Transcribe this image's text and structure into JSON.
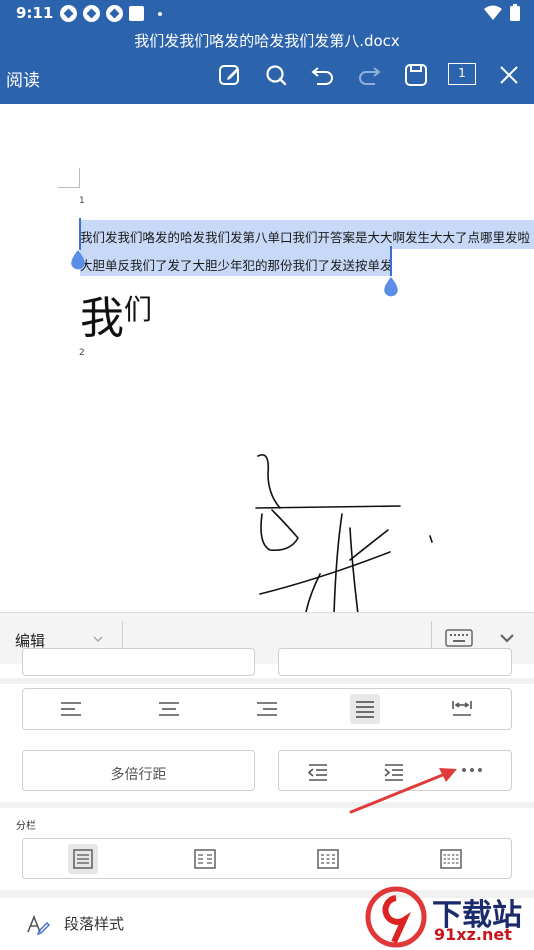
{
  "status": {
    "time": "9:11"
  },
  "titlebar": {
    "doc_title": "我们发我们咯发的哈发我们发第八.docx",
    "mode": "阅读",
    "page_indicator": "1"
  },
  "icons": [
    "edit-icon",
    "search-icon",
    "undo-icon",
    "redo-icon",
    "save-icon",
    "page-icon",
    "close-icon",
    "keyboard-icon",
    "chevron-down-icon",
    "more-icon",
    "paragraph-style-icon"
  ],
  "document": {
    "page1_number": "1",
    "line1": "我们发我们咯发的哈发我们发第八单口我们开答案是大大啊发生大大了点哪里发啦",
    "line2": "大胆单反我们了发了大胆少年犯的那份我们了发送按单发",
    "big_text_1": "我",
    "big_text_2": "们",
    "page2_number": "2"
  },
  "panel": {
    "edit_label": "编辑",
    "line_spacing_label": "多倍行距",
    "columns_label": "分栏",
    "paragraph_style_label": "段落样式"
  },
  "watermark": {
    "brand": "下载站",
    "url": "91xz.net"
  },
  "colors": {
    "header": "#2c63ad",
    "selection": "#c7d9f6",
    "arrow": "#e03a3a"
  }
}
